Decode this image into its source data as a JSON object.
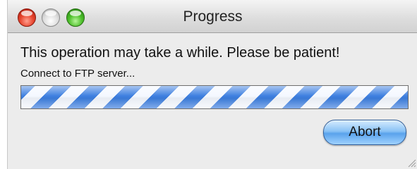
{
  "window": {
    "title": "Progress"
  },
  "titlebar": {
    "buttons": [
      {
        "name": "close",
        "color": "#e8462f"
      },
      {
        "name": "minimize",
        "color": "#dcdcdc"
      },
      {
        "name": "zoom",
        "color": "#4cbf2a"
      }
    ]
  },
  "content": {
    "message": "This operation may take a while. Please be patient!",
    "status": "Connect to FTP server...",
    "progress": {
      "mode": "indeterminate",
      "fraction": 1.0,
      "stripe_color": "#3d7fe0"
    }
  },
  "actions": {
    "abort_label": "Abort"
  }
}
